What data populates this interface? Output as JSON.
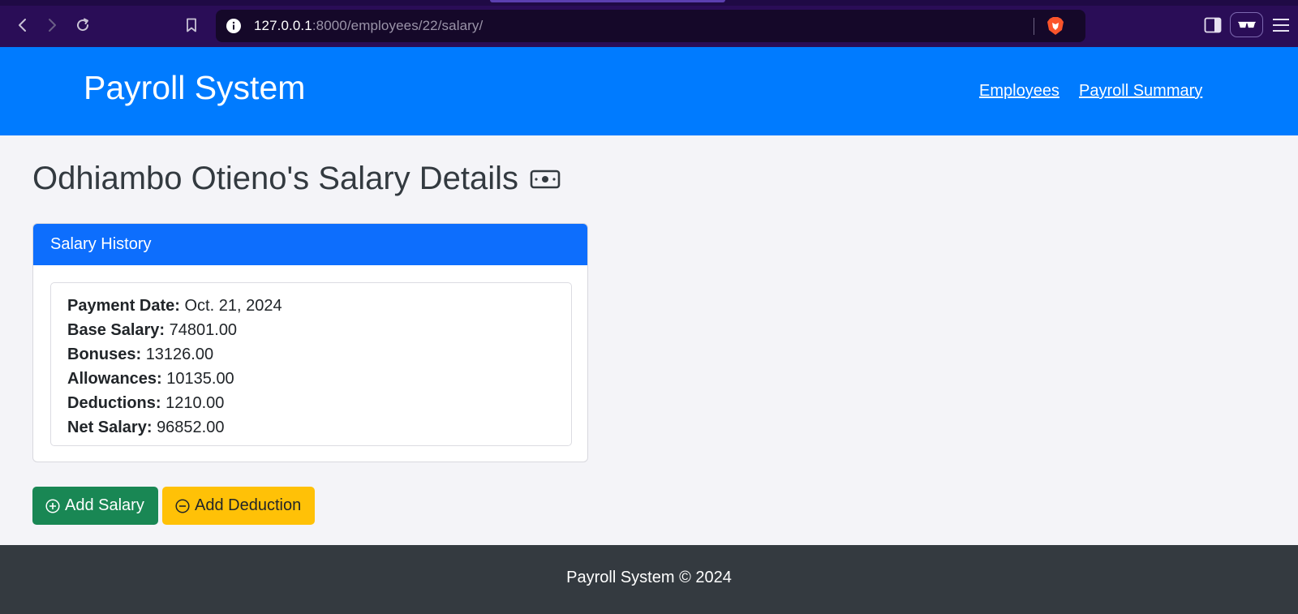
{
  "browser": {
    "url_host": "127.0.0.1",
    "url_path": ":8000/employees/22/salary/"
  },
  "header": {
    "brand": "Payroll System",
    "nav": {
      "employees": "Employees",
      "payroll_summary": "Payroll Summary"
    }
  },
  "main": {
    "title": "Odhiambo Otieno's Salary Details",
    "title_icon": "cash-icon",
    "card_header": "Salary History",
    "record": {
      "payment_date_label": "Payment Date:",
      "payment_date": "Oct. 21, 2024",
      "base_salary_label": "Base Salary:",
      "base_salary": "74801.00",
      "bonuses_label": "Bonuses:",
      "bonuses": "13126.00",
      "allowances_label": "Allowances:",
      "allowances": "10135.00",
      "deductions_label": "Deductions:",
      "deductions": "1210.00",
      "net_salary_label": "Net Salary:",
      "net_salary": "96852.00"
    },
    "buttons": {
      "add_salary": "Add Salary",
      "add_deduction": "Add Deduction"
    }
  },
  "footer": {
    "text": "Payroll System © 2024"
  },
  "colors": {
    "header_blue": "#007bff",
    "card_header_blue": "#0d6efd",
    "success_green": "#198754",
    "warning_yellow": "#ffc107",
    "footer_dark": "#343a40",
    "browser_purple": "#2a0d57"
  }
}
